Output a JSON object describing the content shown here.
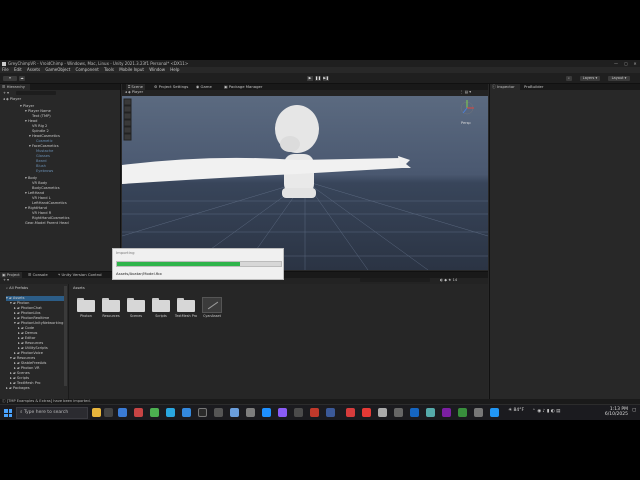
{
  "window": {
    "title": "GreyChimpVR - VroidChimp - Windows, Mac, Linux - Unity 2021.3.23f1 Personal* <DX11>",
    "menu": [
      "File",
      "Edit",
      "Assets",
      "GameObject",
      "Component",
      "Tools",
      "Mobile Input",
      "Window",
      "Help"
    ],
    "controls": [
      "—",
      "▢",
      "✕"
    ]
  },
  "toolbar": {
    "play": "▶",
    "pause": "❚❚",
    "step": "▶❚",
    "layers_label": "Layers",
    "layout_label": "Layout"
  },
  "hierarchy": {
    "tab_label": "Hierarchy",
    "scene_root": "Player",
    "items": [
      "Player",
      "Player Name",
      "Text (TMP)",
      "Head",
      "VR Rig 2",
      "Spindle 2",
      "HeadCosmetics",
      "Cosmetic",
      "FaceCosmetics",
      "Mustache",
      "Glasses",
      "Beard",
      "Blush",
      "Eyebrows",
      "Body",
      "VR Body",
      "BodyCosmetics",
      "LeftHand",
      "VR Hand L",
      "LeftHandCosmetics",
      "RightHand",
      "VR Hand R",
      "RightHandCosmetics",
      "Gear-Model Parent Head"
    ]
  },
  "scene_view": {
    "tabs": [
      "Scene",
      "Project Settings",
      "Game",
      "Package Manager"
    ],
    "breadcrumb": "Player",
    "gizmo_label": "Persp"
  },
  "inspector": {
    "tabs": [
      "Inspector",
      "ProBuilder"
    ]
  },
  "project": {
    "tabs": [
      "Project",
      "Console",
      "Unity Version Control"
    ],
    "favorites_label": "All Prefabs",
    "tree": [
      "Assets",
      "Photon",
      "PhotonChat",
      "PhotonLibs",
      "PhotonRealtime",
      "PhotonUnityNetworking",
      "Code",
      "Demos",
      "Editor",
      "Resources",
      "UtilityScripts",
      "PhotonVoice",
      "Resources",
      "StableFreeAds",
      "Photon VR",
      "Scenes",
      "Scripts",
      "TextMesh Pro",
      "Packages"
    ],
    "breadcrumb": "Assets",
    "folders": [
      "Photon",
      "Resources",
      "Scenes",
      "Scripts",
      "TextMesh Pro",
      "CyanAsset"
    ],
    "item_count_label": "14"
  },
  "loader": {
    "title": "Importing",
    "progress_fraction": 0.75,
    "file": "Assets/Avatar/Model.fbx"
  },
  "status_bar": {
    "message": "[TMP Examples & Extras] have been imported."
  },
  "taskbar": {
    "search_placeholder": "Type here to search",
    "time": "1:13 PM",
    "date": "6/10/2025",
    "weather": "84°F"
  },
  "colors": {
    "editor_bg": "#282828",
    "scene_sky": "#3f4f6a",
    "progress_green": "#2fb44b",
    "taskbar_bg": "#1b1b1f"
  }
}
